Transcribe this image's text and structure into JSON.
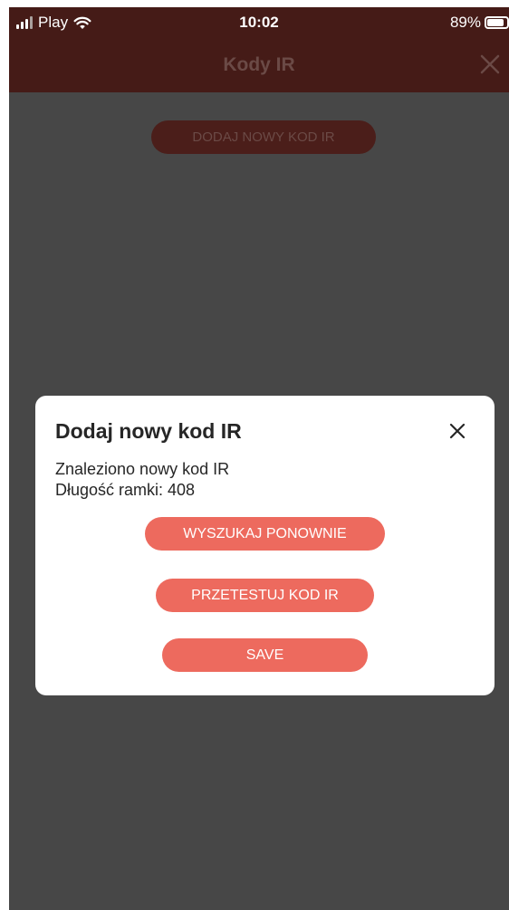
{
  "status_bar": {
    "carrier": "Play",
    "time": "10:02",
    "battery": "89%",
    "battery_level": 0.89
  },
  "header": {
    "title": "Kody IR"
  },
  "main": {
    "add_button_label": "DODAJ NOWY KOD IR"
  },
  "dialog": {
    "title": "Dodaj nowy kod IR",
    "message_line1": "Znaleziono nowy kod IR",
    "message_line2": "Długość ramki: 408",
    "search_again_label": "WYSZUKAJ PONOWNIE",
    "test_label": "PRZETESTUJ KOD IR",
    "save_label": "SAVE"
  },
  "colors": {
    "header_bg": "#451b17",
    "overlay_bg": "#474747",
    "accent": "#ed6a5e"
  },
  "icons": {
    "signal": "signal-bars-icon",
    "wifi": "wifi-icon",
    "battery": "battery-icon",
    "close": "close-icon"
  }
}
